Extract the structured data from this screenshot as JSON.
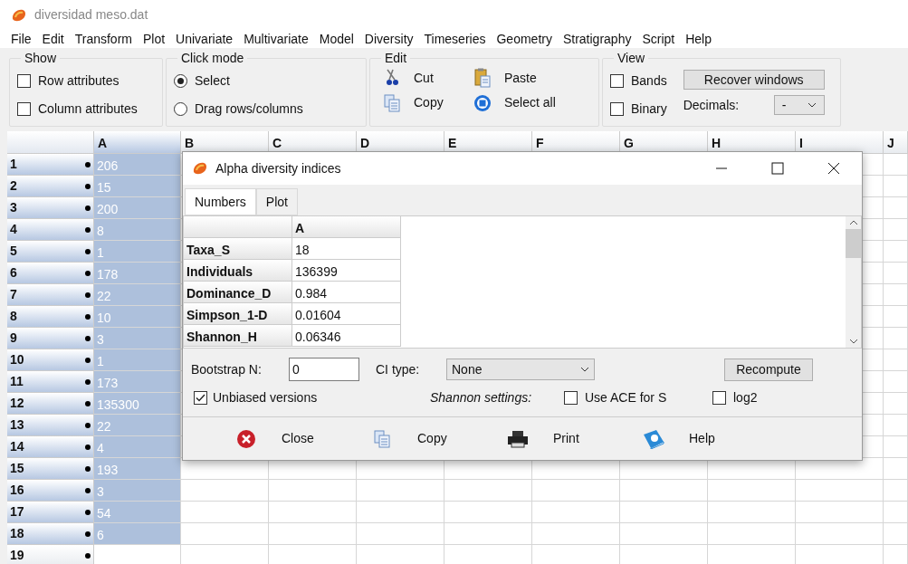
{
  "window": {
    "title": "diversidad meso.dat"
  },
  "menu": [
    "File",
    "Edit",
    "Transform",
    "Plot",
    "Univariate",
    "Multivariate",
    "Model",
    "Diversity",
    "Timeseries",
    "Geometry",
    "Stratigraphy",
    "Script",
    "Help"
  ],
  "toolbar": {
    "show": {
      "title": "Show",
      "options": [
        {
          "label": "Row attributes",
          "checked": false
        },
        {
          "label": "Column attributes",
          "checked": false
        }
      ]
    },
    "click_mode": {
      "title": "Click mode",
      "options": [
        {
          "label": "Select",
          "selected": true
        },
        {
          "label": "Drag rows/columns",
          "selected": false
        }
      ]
    },
    "edit": {
      "title": "Edit",
      "actions": [
        {
          "label": "Cut",
          "kind": "cut"
        },
        {
          "label": "Paste",
          "kind": "paste"
        },
        {
          "label": "Copy",
          "kind": "copy"
        },
        {
          "label": "Select all",
          "kind": "select_all"
        }
      ]
    },
    "view": {
      "title": "View",
      "options": [
        {
          "label": "Bands",
          "checked": false
        },
        {
          "label": "Binary",
          "checked": false
        }
      ],
      "recover_button": "Recover windows",
      "decimals_label": "Decimals:",
      "decimals_value": "-"
    }
  },
  "spreadsheet": {
    "columns": [
      "A",
      "B",
      "C",
      "D",
      "E",
      "F",
      "G",
      "H",
      "I",
      "J"
    ],
    "rows": [
      {
        "label": "1",
        "value": "206",
        "selected": true
      },
      {
        "label": "2",
        "value": "15",
        "selected": true
      },
      {
        "label": "3",
        "value": "200",
        "selected": true
      },
      {
        "label": "4",
        "value": "8",
        "selected": true
      },
      {
        "label": "5",
        "value": "1",
        "selected": true
      },
      {
        "label": "6",
        "value": "178",
        "selected": true
      },
      {
        "label": "7",
        "value": "22",
        "selected": true
      },
      {
        "label": "8",
        "value": "10",
        "selected": true
      },
      {
        "label": "9",
        "value": "3",
        "selected": true
      },
      {
        "label": "10",
        "value": "1",
        "selected": true
      },
      {
        "label": "11",
        "value": "173",
        "selected": true
      },
      {
        "label": "12",
        "value": "135300",
        "selected": true
      },
      {
        "label": "13",
        "value": "22",
        "selected": true
      },
      {
        "label": "14",
        "value": "4",
        "selected": true
      },
      {
        "label": "15",
        "value": "193",
        "selected": true
      },
      {
        "label": "16",
        "value": "3",
        "selected": true
      },
      {
        "label": "17",
        "value": "54",
        "selected": true
      },
      {
        "label": "18",
        "value": "6",
        "selected": true
      },
      {
        "label": "19",
        "selected": false
      }
    ]
  },
  "dialog": {
    "title": "Alpha diversity indices",
    "tabs": [
      {
        "label": "Numbers",
        "selected": true
      },
      {
        "label": "Plot",
        "selected": false
      }
    ],
    "table": {
      "columns": [
        "A"
      ],
      "rows": [
        {
          "name": "Taxa_S",
          "value": "18"
        },
        {
          "name": "Individuals",
          "value": "136399"
        },
        {
          "name": "Dominance_D",
          "value": "0.984"
        },
        {
          "name": "Simpson_1-D",
          "value": "0.01604"
        },
        {
          "name": "Shannon_H",
          "value": "0.06346"
        }
      ]
    },
    "bootstrap_label": "Bootstrap N:",
    "bootstrap_value": "0",
    "ci_label": "CI type:",
    "ci_value": "None",
    "recompute_button": "Recompute",
    "unbiased": {
      "label": "Unbiased versions",
      "checked": true
    },
    "shannon_label": "Shannon settings:",
    "use_ace": {
      "label": "Use ACE for S",
      "checked": false
    },
    "log2": {
      "label": "log2",
      "checked": false
    },
    "buttons": [
      {
        "label": "Close",
        "kind": "close"
      },
      {
        "label": "Copy",
        "kind": "copy"
      },
      {
        "label": "Print",
        "kind": "print"
      },
      {
        "label": "Help",
        "kind": "help"
      }
    ]
  }
}
